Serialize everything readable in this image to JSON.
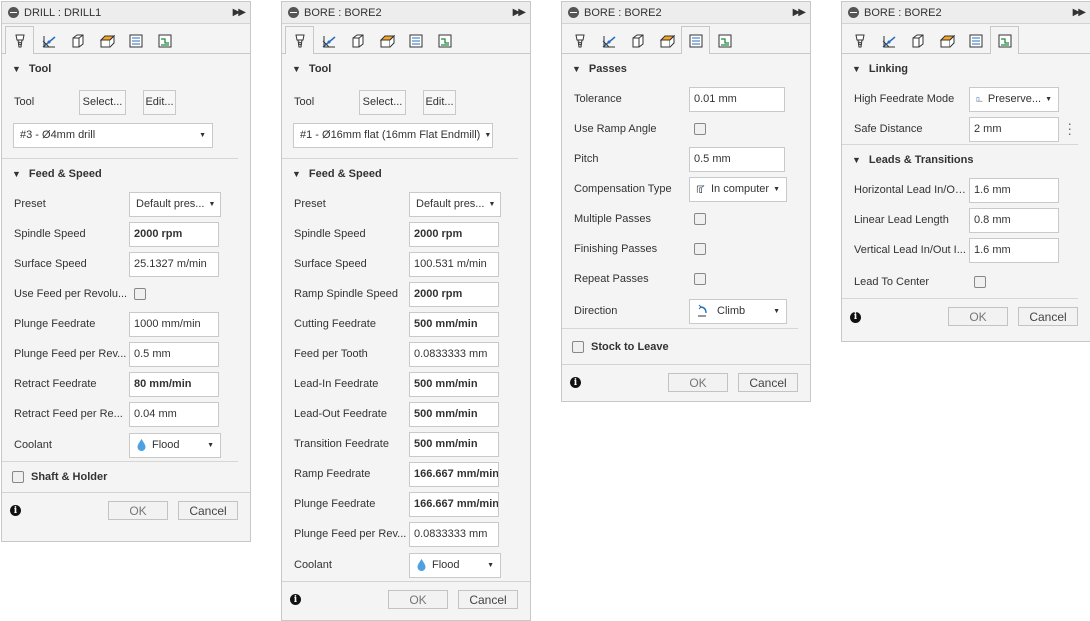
{
  "panels": [
    {
      "title": "DRILL : DRILL1",
      "active_tab": 0,
      "tool_section": {
        "heading": "Tool",
        "tool_label": "Tool",
        "select_label": "Select...",
        "edit_label": "Edit...",
        "tool_value": "#3 - Ø4mm drill"
      },
      "feed_section": {
        "heading": "Feed & Speed",
        "preset_label": "Preset",
        "preset_value": "Default pres...",
        "rows": [
          {
            "label": "Spindle Speed",
            "value": "2000 rpm",
            "bold": true
          },
          {
            "label": "Surface Speed",
            "value": "25.1327 m/min",
            "bold": false
          },
          {
            "label": "Use Feed per Revolu...",
            "checkbox": true
          },
          {
            "label": "Plunge Feedrate",
            "value": "1000 mm/min",
            "bold": false
          },
          {
            "label": "Plunge Feed per Rev...",
            "value": "0.5 mm",
            "bold": false
          },
          {
            "label": "Retract Feedrate",
            "value": "80 mm/min",
            "bold": true
          },
          {
            "label": "Retract Feed per Re...",
            "value": "0.04 mm",
            "bold": false
          }
        ],
        "coolant_label": "Coolant",
        "coolant_value": "Flood"
      },
      "collapsed_label": "Shaft & Holder",
      "ok": "OK",
      "cancel": "Cancel"
    },
    {
      "title": "BORE : BORE2",
      "active_tab": 0,
      "tool_section": {
        "heading": "Tool",
        "tool_label": "Tool",
        "select_label": "Select...",
        "edit_label": "Edit...",
        "tool_value": "#1 - Ø16mm flat (16mm Flat Endmill)"
      },
      "feed_section": {
        "heading": "Feed & Speed",
        "preset_label": "Preset",
        "preset_value": "Default pres...",
        "rows": [
          {
            "label": "Spindle Speed",
            "value": "2000 rpm",
            "bold": true
          },
          {
            "label": "Surface Speed",
            "value": "100.531 m/min",
            "bold": false
          },
          {
            "label": "Ramp Spindle Speed",
            "value": "2000 rpm",
            "bold": true
          },
          {
            "label": "Cutting Feedrate",
            "value": "500 mm/min",
            "bold": true
          },
          {
            "label": "Feed per Tooth",
            "value": "0.0833333 mm",
            "bold": false
          },
          {
            "label": "Lead-In Feedrate",
            "value": "500 mm/min",
            "bold": true
          },
          {
            "label": "Lead-Out Feedrate",
            "value": "500 mm/min",
            "bold": true
          },
          {
            "label": "Transition Feedrate",
            "value": "500 mm/min",
            "bold": true
          },
          {
            "label": "Ramp Feedrate",
            "value": "166.667 mm/min",
            "bold": true
          },
          {
            "label": "Plunge Feedrate",
            "value": "166.667 mm/min",
            "bold": true
          },
          {
            "label": "Plunge Feed per Rev...",
            "value": "0.0833333 mm",
            "bold": false
          }
        ],
        "coolant_label": "Coolant",
        "coolant_value": "Flood"
      },
      "ok": "OK",
      "cancel": "Cancel"
    },
    {
      "title": "BORE : BORE2",
      "active_tab": 4,
      "passes": {
        "heading": "Passes",
        "tolerance_label": "Tolerance",
        "tolerance_value": "0.01 mm",
        "ramp_label": "Use Ramp Angle",
        "pitch_label": "Pitch",
        "pitch_value": "0.5 mm",
        "comp_label": "Compensation Type",
        "comp_value": "In computer",
        "multiple_label": "Multiple Passes",
        "finishing_label": "Finishing Passes",
        "repeat_label": "Repeat Passes",
        "direction_label": "Direction",
        "direction_value": "Climb"
      },
      "collapsed_label": "Stock to Leave",
      "ok": "OK",
      "cancel": "Cancel"
    },
    {
      "title": "BORE : BORE2",
      "active_tab": 5,
      "linking": {
        "heading": "Linking",
        "hfm_label": "High Feedrate Mode",
        "hfm_value": "Preserve...",
        "safe_label": "Safe Distance",
        "safe_value": "2 mm"
      },
      "leads": {
        "heading": "Leads & Transitions",
        "h_label": "Horizontal Lead In/Ou...",
        "h_value": "1.6 mm",
        "l_label": "Linear Lead Length",
        "l_value": "0.8 mm",
        "v_label": "Vertical Lead In/Out I...",
        "v_value": "1.6 mm",
        "c_label": "Lead To Center"
      },
      "ok": "OK",
      "cancel": "Cancel"
    }
  ],
  "icons": [
    "tool-icon",
    "geometry-icon",
    "heights-icon",
    "passes-icon",
    "linking-icon"
  ]
}
